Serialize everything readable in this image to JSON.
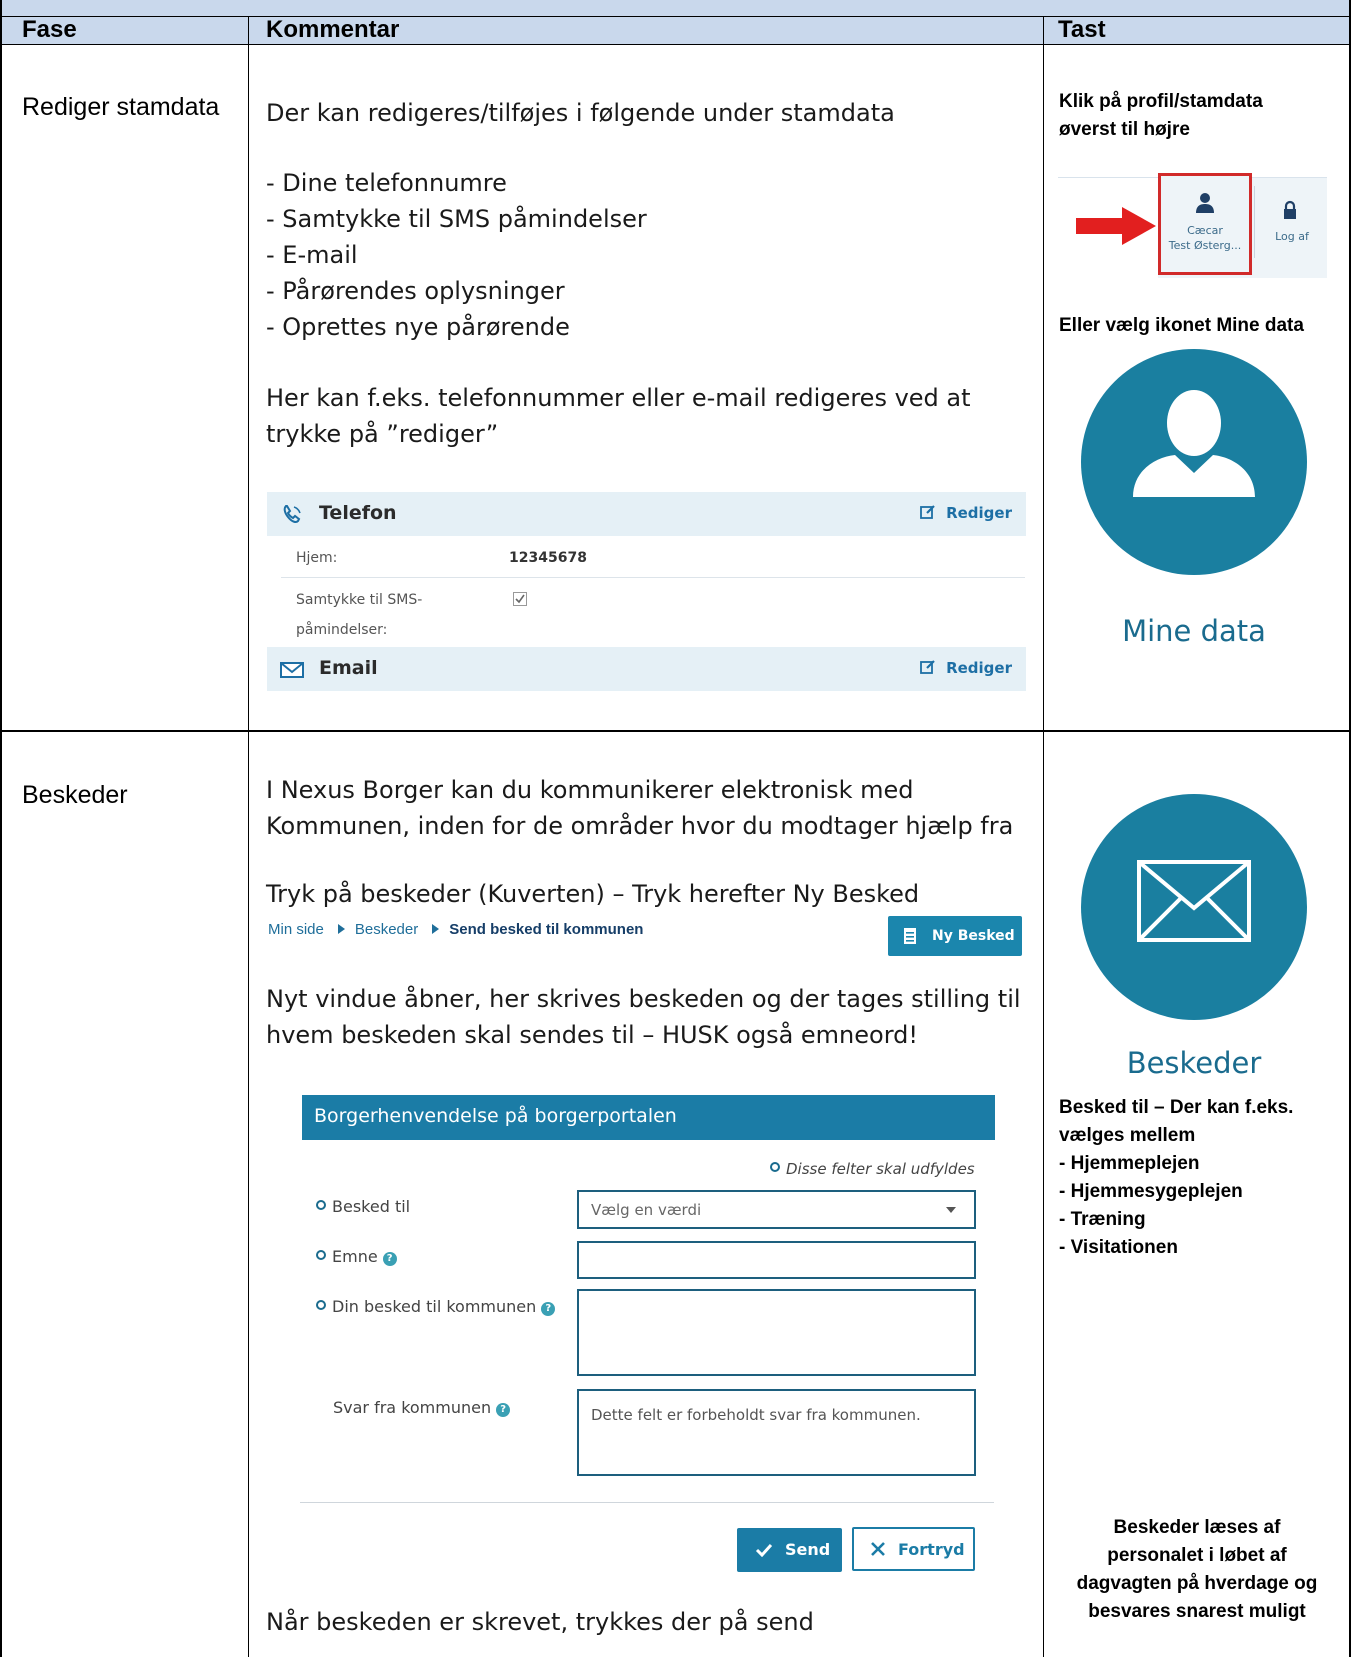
{
  "table": {
    "headers": {
      "fase": "Fase",
      "kommentar": "Kommentar",
      "tast": "Tast"
    }
  },
  "row1": {
    "fase": "Rediger stamdata",
    "intro": "Der kan redigeres/tilføjes i følgende under stamdata",
    "bullets": [
      "- Dine telefonnumre",
      "- Samtykke til SMS påmindelser",
      "- E-mail",
      "- Pårørendes oplysninger",
      "- Oprettes nye pårørende"
    ],
    "note_line1": "Her kan f.eks. telefonnummer eller e-mail redigeres ved at",
    "note_line2": "trykke på ”rediger”",
    "panel": {
      "telefon_title": "Telefon",
      "rediger": "Rediger",
      "hjem_label": "Hjem:",
      "hjem_value": "12345678",
      "sms_label_1": "Samtykke til SMS-",
      "sms_label_2": "påmindelser:",
      "sms_checked": true,
      "email_title": "Email"
    },
    "tast": {
      "line1": "Klik på profil/stamdata",
      "line2": "øverst til højre",
      "profile_name_1": "Cæcar",
      "profile_name_2": "Test Østerg...",
      "logout": "Log af",
      "alt_text": "Eller vælg ikonet Mine data",
      "icon_caption": "Mine data",
      "icon": "user-icon"
    }
  },
  "row2": {
    "fase": "Beskeder",
    "p1_line1": "I Nexus Borger kan du kommunikerer elektronisk med",
    "p1_line2": "Kommunen, inden for de områder hvor du modtager hjælp fra",
    "p2": "Tryk på beskeder (Kuverten) – Tryk herefter Ny Besked",
    "breadcrumb": [
      "Min side",
      "Beskeder",
      "Send besked til kommunen"
    ],
    "ny_besked": "Ny Besked",
    "p3_line1": "Nyt vindue åbner, her skrives beskeden og der tages stilling til",
    "p3_line2": "hvem beskeden skal sendes til – HUSK også emneord!",
    "form": {
      "title": "Borgerhenvendelse på borgerportalen",
      "required_note": "Disse felter skal udfyldes",
      "besked_til_label": "Besked til",
      "besked_til_placeholder": "Vælg en værdi",
      "emne_label": "Emne",
      "din_besked_label": "Din besked til kommunen",
      "svar_label": "Svar fra kommunen",
      "svar_text": "Dette felt er forbeholdt svar fra kommunen.",
      "send": "Send",
      "fortryd": "Fortryd"
    },
    "p4": "Når beskeden er skrevet, trykkes der på send",
    "tast": {
      "icon": "envelope-icon",
      "icon_caption": "Beskeder",
      "besked_til_1": "Besked til – Der kan f.eks.",
      "besked_til_2": "vælges mellem",
      "options": [
        "- Hjemmeplejen",
        "- Hjemmesygeplejen",
        "- Træning",
        "- Visitationen"
      ],
      "footer_1": "Beskeder læses af",
      "footer_2": "personalet i løbet af",
      "footer_3": "dagvagten på hverdage og",
      "footer_4": "besvares snarest muligt"
    }
  },
  "colors": {
    "header_bg": "#c9d8ec",
    "accent": "#1a7fa0",
    "panel_bg": "#e5f0f6",
    "highlight_red": "#d12a2a"
  }
}
